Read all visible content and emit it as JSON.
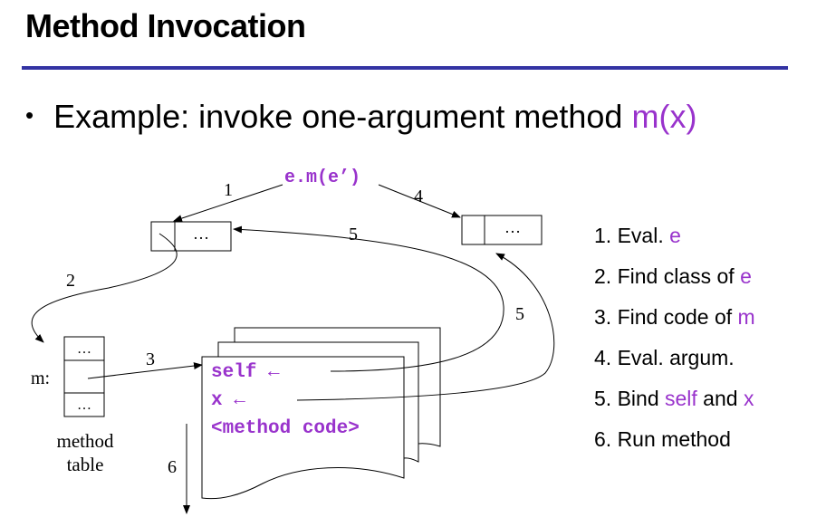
{
  "slide": {
    "title": "Method Invocation",
    "bullet": {
      "prefix": "Example: invoke one-argument method ",
      "highlight": "m(x)"
    }
  },
  "diagram": {
    "call_expr": "e.m(e’)",
    "ellipsis": "…",
    "arrow_labels": {
      "one": "1",
      "two": "2",
      "three": "3",
      "four": "4",
      "five_top": "5",
      "five_right": "5",
      "six": "6"
    },
    "method_table_slot_label": "m:",
    "method_table_caption": [
      "method",
      "table"
    ],
    "activation_record": {
      "self_line": "self ←",
      "x_line": "x ←",
      "code_line": "<method code>"
    }
  },
  "steps": [
    {
      "text": "1. Eval. ",
      "highlight": "e"
    },
    {
      "text": "2. Find class of ",
      "highlight": "e"
    },
    {
      "text": "3. Find code of ",
      "highlight": "m"
    },
    {
      "text": "4. Eval. argum.",
      "highlight": ""
    },
    {
      "text": "5. Bind ",
      "highlight": "self",
      "middle": " and ",
      "highlight2": "x"
    },
    {
      "text": "6. Run method",
      "highlight": ""
    }
  ],
  "colors": {
    "accent_purple": "#9933cc",
    "title_rule": "#3333a3",
    "text": "#000000"
  }
}
